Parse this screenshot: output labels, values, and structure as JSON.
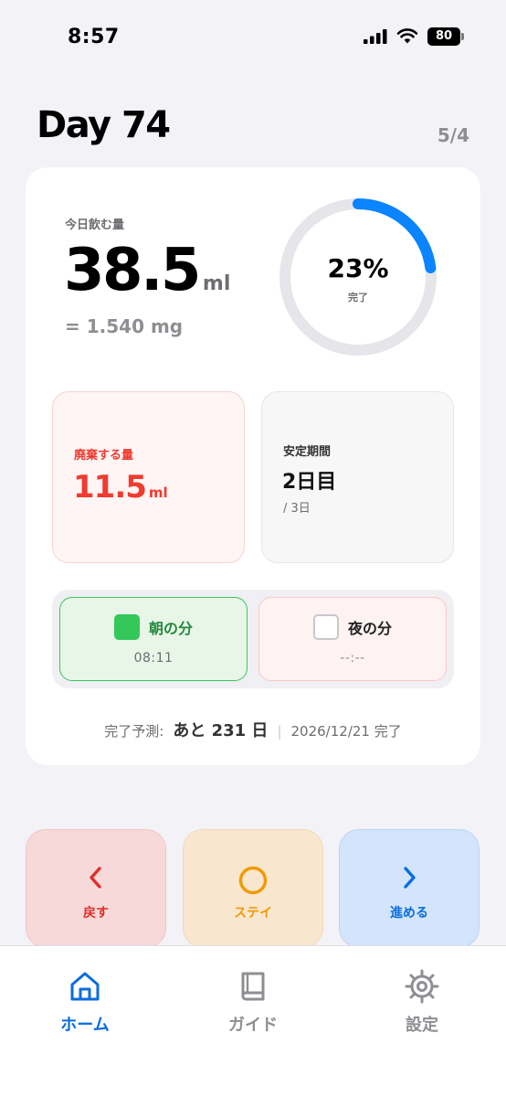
{
  "status_bar": {
    "time": "8:57",
    "battery": "80"
  },
  "header": {
    "title": "Day 74",
    "counter": "5/4"
  },
  "today": {
    "label": "今日飲む量",
    "value": "38.5",
    "unit": "ml",
    "mg": "= 1.540 mg",
    "progress_text": "23%",
    "progress_fraction": 0.23,
    "progress_sub": "完了"
  },
  "discard": {
    "label": "廃棄する量",
    "value": "11.5",
    "unit": "ml"
  },
  "stable": {
    "label": "安定期間",
    "value": "2日目",
    "sub": "/ 3日"
  },
  "doses": {
    "morning": {
      "label": "朝の分",
      "time": "08:11",
      "checked": true
    },
    "night": {
      "label": "夜の分",
      "time": "--:--",
      "checked": false
    }
  },
  "forecast": {
    "label": "完了予測:",
    "remaining": "あと 231 日",
    "separator": "|",
    "date": "2026/12/21 完了"
  },
  "actions": {
    "back": "戻す",
    "stay": "ステイ",
    "next": "進める"
  },
  "tabs": {
    "home": "ホーム",
    "guide": "ガイド",
    "settings": "設定"
  },
  "colors": {
    "accent": "#0a84ff",
    "ring_track": "#e5e5ea",
    "discard": "#ef3b30",
    "check_on": "#34c759",
    "stay": "#f09a00"
  }
}
